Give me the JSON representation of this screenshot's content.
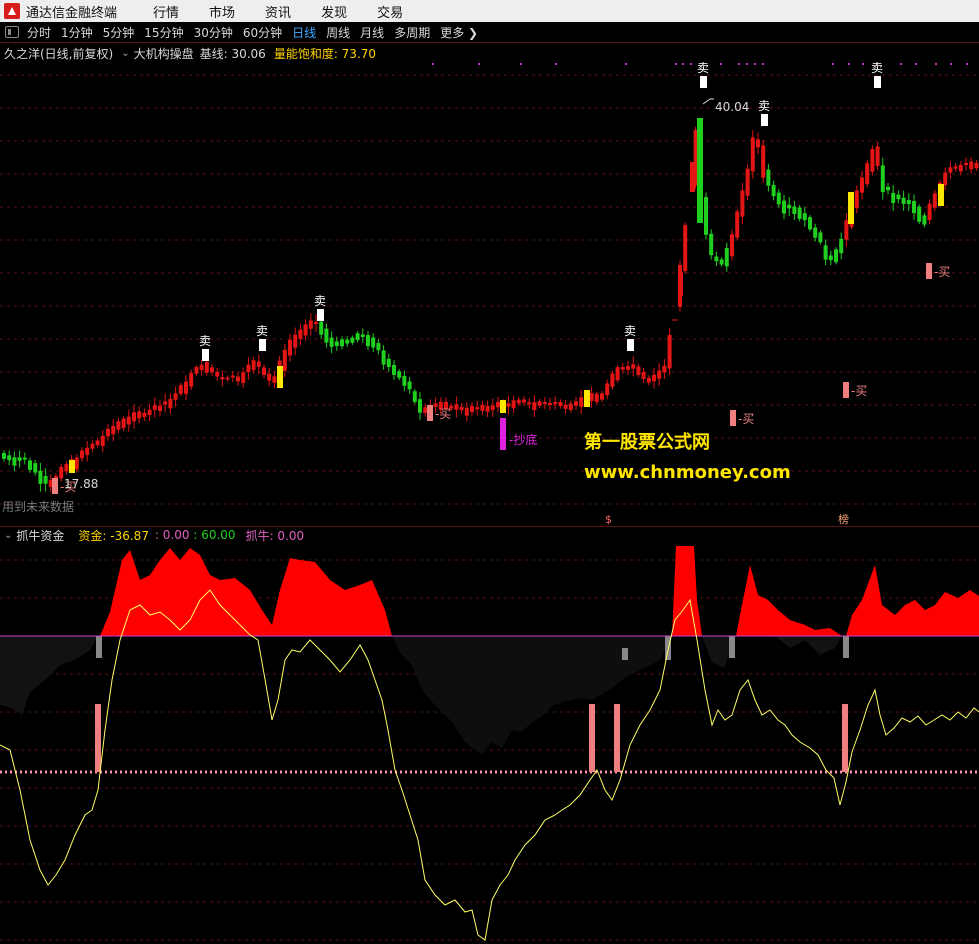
{
  "app": {
    "title": "通达信金融终端"
  },
  "menu": [
    "行情",
    "市场",
    "资讯",
    "发现",
    "交易"
  ],
  "periods": {
    "items": [
      "分时",
      "1分钟",
      "5分钟",
      "15分钟",
      "30分钟",
      "60分钟",
      "日线",
      "周线",
      "月线",
      "多周期",
      "更多 ❯"
    ],
    "active": "日线"
  },
  "main_panel": {
    "stock": "久之洋(日线,前复权)",
    "indicator": "大机构操盘",
    "jixian": "基线: 30.06",
    "liangneng": "量能饱和度: 73.70",
    "high_label": "40.04",
    "low_label": "17.88",
    "future_note": "用到未来数据",
    "sell_label": "卖",
    "buy_label": "买",
    "chaodi_label": "抄底",
    "bottom_marks": [
      "$",
      "榜"
    ]
  },
  "watermark": {
    "title": "第一股票公式网",
    "url": "www.chnmoney.com"
  },
  "sub_panel": {
    "name": "抓牛资金",
    "zijin": "资金: -36.87",
    "v1": ": 0.00",
    "v2": ": 60.00",
    "zhuaniu": "抓牛: 0.00"
  },
  "colors": {
    "up": "#e41515",
    "down": "#1fd01f",
    "signal_yellow": "#ffe600",
    "sell_marker": "#ffffff",
    "buy_marker": "#f08080",
    "chaodi": "#e020e0",
    "fund_area": "#ff0000",
    "line": "#ffff66",
    "baseline": "#cc44cc"
  },
  "icons": [
    "app-logo-icon",
    "panel-toggle-icon",
    "collapse-toggle-icon"
  ]
}
